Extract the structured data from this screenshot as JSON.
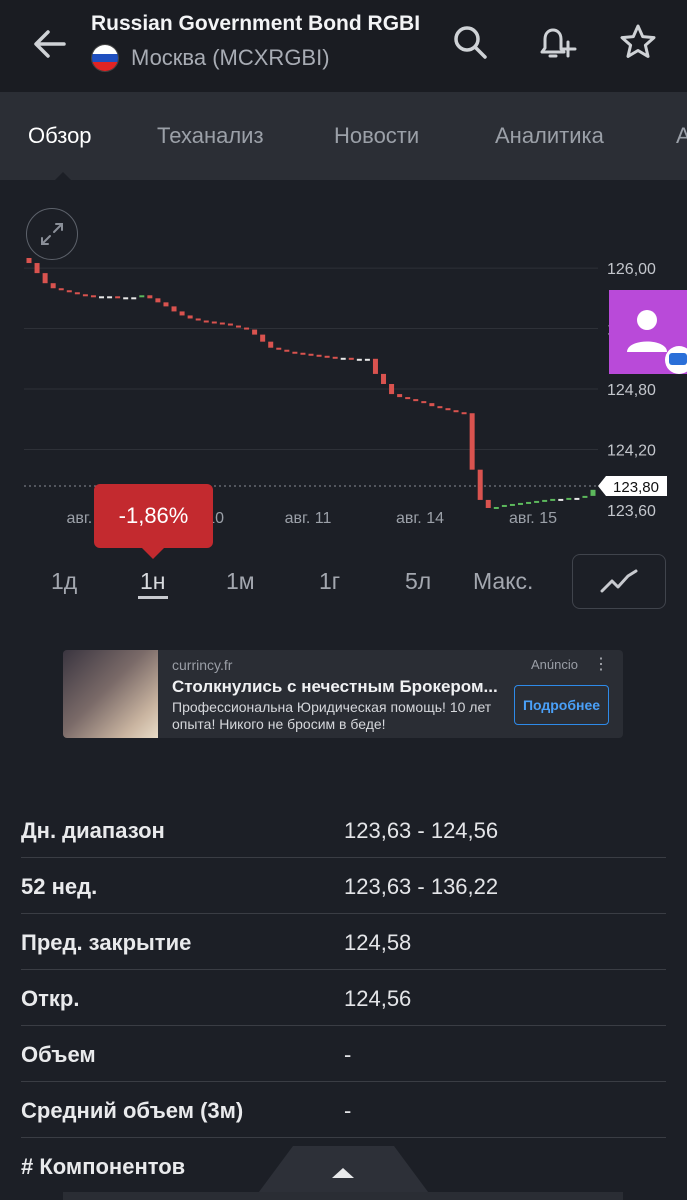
{
  "header": {
    "title": "Russian Government Bond RGBI",
    "exchange": "Москва (MCXRGBI)"
  },
  "tabs": [
    "Обзор",
    "Теханализ",
    "Новости",
    "Аналитика",
    "А"
  ],
  "chart": {
    "price_label": "123,80",
    "change_tooltip": "-1,86%",
    "colors": {
      "down": "#d9534f",
      "up": "#5cb85c",
      "tooltip": "#c32a2f"
    }
  },
  "ranges": [
    "1д",
    "1н",
    "1м",
    "1г",
    "5л",
    "Макс."
  ],
  "ad": {
    "source": "currincy.fr",
    "label": "Anúncio",
    "headline": "Столкнулись с нечестным Брокером...",
    "body": "Профессиональна Юридическая помощь! 10 лет опыта! Никого не бросим в беде!",
    "cta": "Подробнее"
  },
  "stats": [
    {
      "label": "Дн. диапазон",
      "value": "123,63 - 124,56"
    },
    {
      "label": "52 нед.",
      "value": "123,63 - 136,22"
    },
    {
      "label": "Пред. закрытие",
      "value": "124,58"
    },
    {
      "label": "Откр.",
      "value": "124,56"
    },
    {
      "label": "Объем",
      "value": "-"
    },
    {
      "label": "Средний объем (3м)",
      "value": "-"
    },
    {
      "label": "# Компонентов",
      "value": ""
    }
  ],
  "chart_data": {
    "type": "candlestick",
    "x_ticks": [
      "авг. 0",
      "авг. 10",
      "авг. 11",
      "авг. 14",
      "авг. 15"
    ],
    "y_ticks": [
      "126,00",
      "125,40",
      "124,80",
      "124,20",
      "123,60"
    ],
    "ylim": [
      123.6,
      126.1
    ],
    "grid": true,
    "series": [
      {
        "name": "RGBI",
        "values": [
          126.05,
          125.95,
          125.85,
          125.8,
          125.78,
          125.76,
          125.74,
          125.73,
          125.72,
          125.72,
          125.72,
          125.71,
          125.71,
          125.71,
          125.73,
          125.7,
          125.66,
          125.62,
          125.57,
          125.53,
          125.5,
          125.48,
          125.47,
          125.46,
          125.45,
          125.43,
          125.41,
          125.39,
          125.34,
          125.27,
          125.21,
          125.19,
          125.17,
          125.16,
          125.15,
          125.14,
          125.13,
          125.12,
          125.11,
          125.11,
          125.1,
          125.1,
          125.1,
          124.95,
          124.85,
          124.75,
          124.72,
          124.7,
          124.68,
          124.66,
          124.63,
          124.61,
          124.59,
          124.57,
          124.56,
          124.0,
          123.7,
          123.62,
          123.63,
          123.65,
          123.66,
          123.67,
          123.68,
          123.69,
          123.7,
          123.71,
          123.71,
          123.72,
          123.72,
          123.74,
          123.8
        ]
      }
    ]
  }
}
